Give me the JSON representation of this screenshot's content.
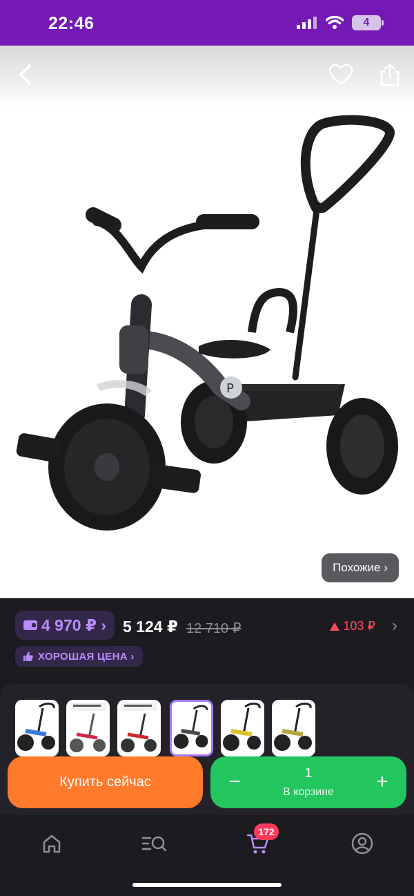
{
  "status_bar": {
    "time": "22:46",
    "battery": "4"
  },
  "product": {
    "similar_label": "Похожие ›",
    "image_icon": "tricycle-image"
  },
  "price": {
    "wallet_price": "4 970 ₽ ›",
    "regular_price": "5 124 ₽",
    "old_price": "12 710 ₽",
    "price_diff": "103 ₽",
    "good_price_label": "ХОРОШАЯ ЦЕНА ›"
  },
  "variants": {
    "thumbnails": [
      {
        "name": "variant-blue",
        "accent": "#3a79d8"
      },
      {
        "name": "variant-pink",
        "accent": "#d02a47"
      },
      {
        "name": "variant-red",
        "accent": "#cc2b2b"
      },
      {
        "name": "variant-gray",
        "accent": "#4a4a4e",
        "selected": true
      },
      {
        "name": "variant-yellow",
        "accent": "#e0c12b"
      },
      {
        "name": "variant-olive",
        "accent": "#b7a63a"
      }
    ]
  },
  "actions": {
    "buy_now": "Купить сейчас",
    "quantity": "1",
    "in_cart_label": "В корзине",
    "minus": "−",
    "plus": "+"
  },
  "nav": {
    "cart_badge": "172",
    "items": [
      "home-icon",
      "catalog-search-icon",
      "cart-icon",
      "profile-icon"
    ]
  },
  "colors": {
    "status_bar": "#7418b6",
    "accent_purple": "#b98cff",
    "buy_now": "#ff7a2a",
    "cart": "#22c55e",
    "alert_red": "#ff4b5c"
  }
}
